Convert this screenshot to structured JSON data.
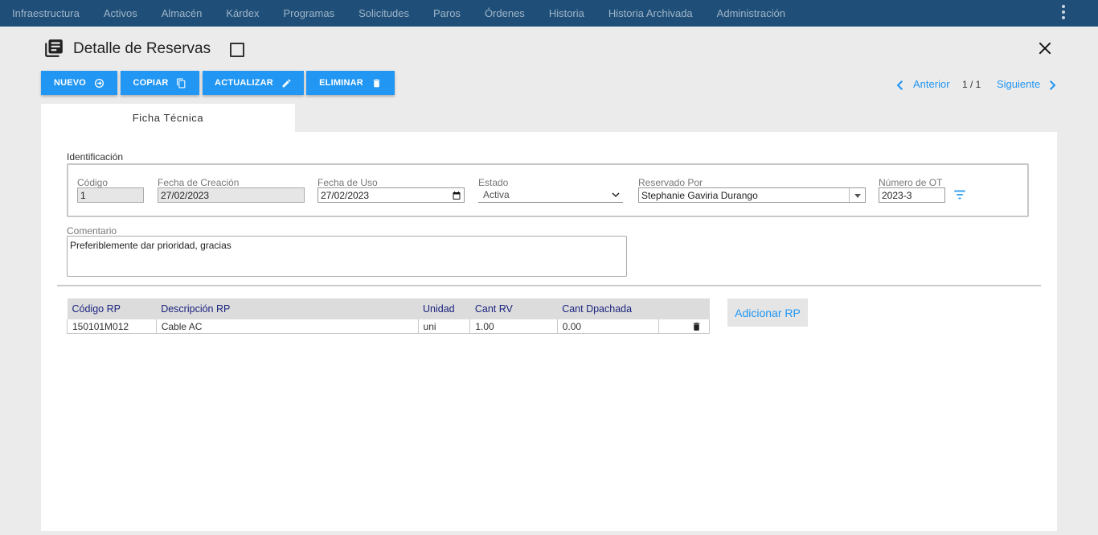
{
  "nav": {
    "items": [
      "Infraestructura",
      "Activos",
      "Almacén",
      "Kárdex",
      "Programas",
      "Solicitudes",
      "Paros",
      "Órdenes",
      "Historia",
      "Historia Archivada",
      "Administración"
    ],
    "more_icon": "kebab-menu-icon"
  },
  "header": {
    "title": "Detalle de Reservas",
    "icon": "library-books-icon",
    "close_icon": "close-icon"
  },
  "toolbar": {
    "new_label": "NUEVO",
    "copy_label": "COPIAR",
    "update_label": "ACTUALIZAR",
    "delete_label": "ELIMINAR",
    "accent": "#2196f3"
  },
  "pager": {
    "prev_label": "Anterior",
    "count": "1 / 1",
    "next_label": "Siguiente"
  },
  "tabs": {
    "active": "Ficha Técnica"
  },
  "form": {
    "section_label": "Identificación",
    "codigo": {
      "label": "Código",
      "value": "1"
    },
    "fecha_creacion": {
      "label": "Fecha de Creación",
      "value": "27/02/2023"
    },
    "fecha_uso": {
      "label": "Fecha de Uso",
      "value": "27/02/2023"
    },
    "estado": {
      "label": "Estado",
      "value": "Activa"
    },
    "reservado_por": {
      "label": "Reservado Por",
      "value": "Stephanie Gaviria Durango"
    },
    "numero_ot": {
      "label": "Número de OT",
      "value": "2023-3"
    },
    "comentario": {
      "label": "Comentario",
      "value": "Preferiblemente dar prioridad, gracias"
    }
  },
  "table": {
    "headers": [
      "Código RP",
      "Descripción RP",
      "Unidad",
      "Cant RV",
      "Cant Dpachada"
    ],
    "rows": [
      {
        "codigo": "150101M012",
        "descripcion": "Cable AC",
        "unidad": "uni",
        "cant_rv": "1.00",
        "cant_despachada": "0.00"
      }
    ]
  },
  "add_rp_label": "Adicionar RP"
}
